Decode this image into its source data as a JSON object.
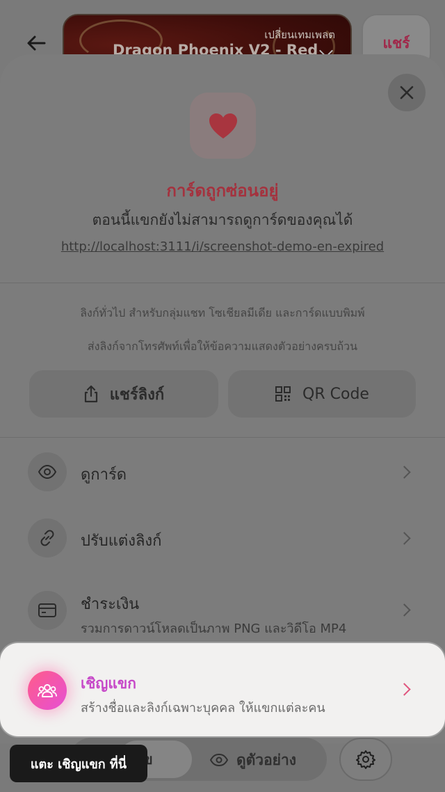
{
  "header": {
    "template_change_label": "เปลี่ยนเทมเพลต",
    "template_name": "Dragon Phoenix V2 - Red",
    "share_button": "แชร์"
  },
  "modal": {
    "hidden_title": "การ์ดถูกซ่อนอยู่",
    "hidden_subtitle": "ตอนนี้แขกยังไม่สามารถดูการ์ดของคุณได้",
    "card_url": "http://localhost:3111/i/screenshot-demo-en-expired",
    "info_line1": "ลิงก์ทั่วไป สำหรับกลุ่มแชท โซเชียลมีเดีย และการ์ดแบบพิมพ์",
    "info_line2": "ส่งลิงก์จากโทรศัพท์เพื่อให้ข้อความแสดงตัวอย่างครบถ้วน",
    "share_link_button": "แชร์ลิงก์",
    "qr_code_button": "QR Code",
    "rows": [
      {
        "label": "ดูการ์ด",
        "icon": "eye-icon"
      },
      {
        "label": "ปรับแต่งลิงก์",
        "icon": "link-icon"
      },
      {
        "label": "ชำระเงิน",
        "desc": "รวมการดาวน์โหลดเป็นภาพ PNG และวิดีโอ MP4",
        "icon": "credit-card-icon"
      }
    ],
    "invite": {
      "title": "เชิญแขก",
      "desc": "สร้างชื่อและลิงก์เฉพาะบุคคล ให้แขกแต่ละคน",
      "icon": "guests-icon"
    }
  },
  "bottom_bar": {
    "left_tab_partial": "ข",
    "preview_label": "ดูตัวอย่าง"
  },
  "tooltip": {
    "text": "แตะ เชิญแขก ที่นี่"
  },
  "colors": {
    "accent_pink": "#e0567e",
    "invite_title": "#c648c8",
    "hidden_title": "#a4323e"
  }
}
